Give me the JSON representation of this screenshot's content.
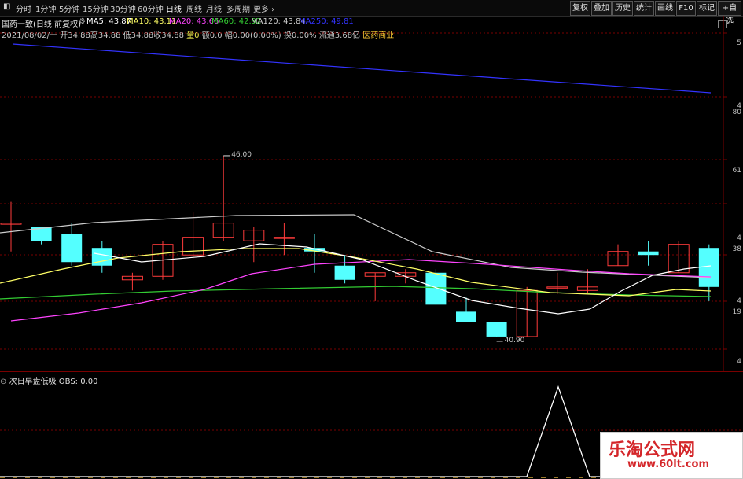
{
  "toolbar": {
    "left_icon": "panel-toggle-icon",
    "periods": [
      "分时",
      "1分钟",
      "5分钟",
      "15分钟",
      "30分钟",
      "60分钟",
      "日线",
      "周线",
      "月线",
      "多周期",
      "更多"
    ],
    "active_period": "日线",
    "right_buttons": [
      "复权",
      "叠加",
      "历史",
      "统计",
      "画线",
      "F10",
      "标记",
      "+自选"
    ]
  },
  "info": {
    "stock": "国药一致(日线 前复权)",
    "ma5": "MA5: 43.87",
    "ma10": "MA10: 43.11",
    "ma20": "MA20: 43.66",
    "ma60": "MA60: 42.92",
    "ma120": "MA120: 43.84",
    "ma250": "MA250: 49.81",
    "date": "2021/08/02/一",
    "open": "开34.88",
    "high": "高34.88",
    "low": "低34.88",
    "close": "收34.88",
    "vol": "量0",
    "amount": "额0.0",
    "amp": "幅0.00(0.00%)",
    "turn": "换0.00%",
    "float": "流通3.68亿",
    "sector": "医药商业"
  },
  "colors": {
    "ma5": "#ffffff",
    "ma10": "#ffff66",
    "ma20": "#ff44ff",
    "ma60": "#33cc33",
    "ma120": "#cccccc",
    "ma250": "#3333ff",
    "up": "#ff3b3b",
    "down": "#54ffff",
    "grid": "#7a0000"
  },
  "annotations": {
    "high_label": "46.00",
    "low_label": "40.90"
  },
  "yaxis_labels": [
    "5",
    "4",
    "80",
    "61",
    "4",
    "38",
    "4",
    "19",
    "4"
  ],
  "oscillator": {
    "title": "次日早盘低吸",
    "obs": "OBS: 0.00"
  },
  "watermark": {
    "line1": "乐淘公式网",
    "line2": "www.60lt.com"
  },
  "chart_data": {
    "type": "candlestick",
    "candles": [
      {
        "o": 44.1,
        "h": 44.7,
        "l": 43.3,
        "c": 44.1
      },
      {
        "o": 44.0,
        "h": 44.0,
        "l": 43.5,
        "c": 43.6
      },
      {
        "o": 43.8,
        "h": 44.1,
        "l": 42.9,
        "c": 43.0
      },
      {
        "o": 43.4,
        "h": 43.6,
        "l": 42.7,
        "c": 42.9
      },
      {
        "o": 42.5,
        "h": 42.7,
        "l": 42.2,
        "c": 42.6
      },
      {
        "o": 42.6,
        "h": 43.6,
        "l": 42.5,
        "c": 43.5
      },
      {
        "o": 43.2,
        "h": 44.4,
        "l": 43.1,
        "c": 43.7
      },
      {
        "o": 43.7,
        "h": 46.0,
        "l": 43.6,
        "c": 44.1
      },
      {
        "o": 43.6,
        "h": 44.0,
        "l": 43.0,
        "c": 43.9
      },
      {
        "o": 43.7,
        "h": 44.1,
        "l": 43.2,
        "c": 43.7
      },
      {
        "o": 43.4,
        "h": 43.8,
        "l": 42.7,
        "c": 43.3
      },
      {
        "o": 42.9,
        "h": 43.2,
        "l": 42.4,
        "c": 42.5
      },
      {
        "o": 42.6,
        "h": 42.7,
        "l": 41.9,
        "c": 42.7
      },
      {
        "o": 42.6,
        "h": 42.8,
        "l": 42.4,
        "c": 42.7
      },
      {
        "o": 42.7,
        "h": 42.8,
        "l": 41.8,
        "c": 41.8
      },
      {
        "o": 41.6,
        "h": 42.0,
        "l": 41.3,
        "c": 41.3
      },
      {
        "o": 41.3,
        "h": 41.3,
        "l": 40.9,
        "c": 40.9
      },
      {
        "o": 40.9,
        "h": 42.3,
        "l": 40.9,
        "c": 42.2
      },
      {
        "o": 42.3,
        "h": 42.7,
        "l": 42.1,
        "c": 42.3
      },
      {
        "o": 42.2,
        "h": 42.8,
        "l": 42.1,
        "c": 42.3
      },
      {
        "o": 42.9,
        "h": 43.5,
        "l": 42.9,
        "c": 43.3
      },
      {
        "o": 43.3,
        "h": 43.6,
        "l": 42.9,
        "c": 43.2
      },
      {
        "o": 42.7,
        "h": 43.6,
        "l": 42.7,
        "c": 43.5
      },
      {
        "o": 43.4,
        "h": 43.5,
        "l": 41.9,
        "c": 42.3
      }
    ],
    "ylim": [
      40.3,
      45.4
    ]
  }
}
